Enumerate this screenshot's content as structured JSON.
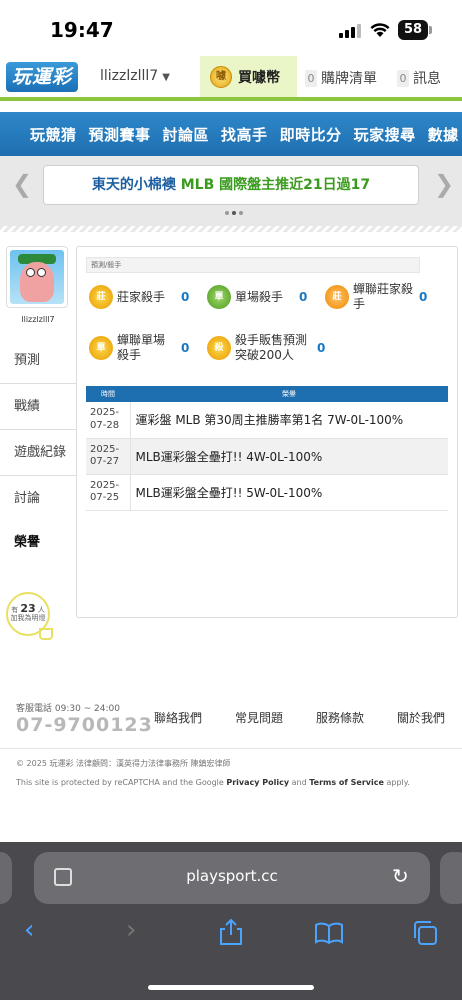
{
  "status_bar": {
    "time": "19:47",
    "battery": "58"
  },
  "topnav": {
    "logo_text": "玩運彩",
    "username": "llizzlzlll7",
    "coins_label": "買噱幣",
    "cart_count": "0",
    "cart_label": "購牌清單",
    "msg_count": "0",
    "msg_label": "訊息"
  },
  "main_menu": [
    "玩競猜",
    "預測賽事",
    "討論區",
    "找高手",
    "即時比分",
    "玩家搜尋",
    "數據"
  ],
  "ticker": {
    "part1": "東天的小棉襖",
    "part2": "MLB 國際盤主推近21日過17"
  },
  "sidebar": {
    "username": "llizzlzlll7",
    "tabs": [
      "預測",
      "戰績",
      "遊戲紀錄",
      "討論",
      "榮譽"
    ],
    "followers_prefix": "有",
    "followers_count": "23",
    "followers_suffix": "人",
    "followers_note": "加我為明燈"
  },
  "panel": {
    "breadcrumb": "預測/殺手",
    "badges": [
      {
        "icon": "莊",
        "label": "莊家殺手",
        "count": "0",
        "color": "gold"
      },
      {
        "icon": "單",
        "label": "單場殺手",
        "count": "0",
        "color": "green"
      },
      {
        "icon": "莊",
        "label": "蟬聯莊家殺手",
        "count": "0",
        "color": "orange"
      },
      {
        "icon": "單",
        "label": "蟬聯單場殺手",
        "count": "0",
        "color": "gold"
      },
      {
        "icon": "殺",
        "label": "殺手販售預測突破200人",
        "count": "0",
        "color": "gold"
      }
    ],
    "table": {
      "headers": [
        "時間",
        "榮譽"
      ],
      "rows": [
        {
          "date": "2025-07-28",
          "title": "運彩盤 MLB 第30周主推勝率第1名 7W-0L-100%"
        },
        {
          "date": "2025-07-27",
          "title": "MLB運彩盤全壘打!! 4W-0L-100%"
        },
        {
          "date": "2025-07-25",
          "title": "MLB運彩盤全壘打!! 5W-0L-100%"
        }
      ]
    }
  },
  "footer": {
    "hotline_label": "客服電話 09:30 ~ 24:00",
    "hotline": "07-9700123",
    "links": [
      "聯絡我們",
      "常見問題",
      "服務條款",
      "關於我們"
    ],
    "copyright": "© 2025 玩運彩 法律顧問：漢英得力法律事務所 陳鎮宏律師",
    "recaptcha_pre": "This site is protected by reCAPTCHA and the Google",
    "privacy": "Privacy Policy",
    "and": "and",
    "terms": "Terms of Service",
    "apply": "apply."
  },
  "browser": {
    "url": "playsport.cc"
  }
}
